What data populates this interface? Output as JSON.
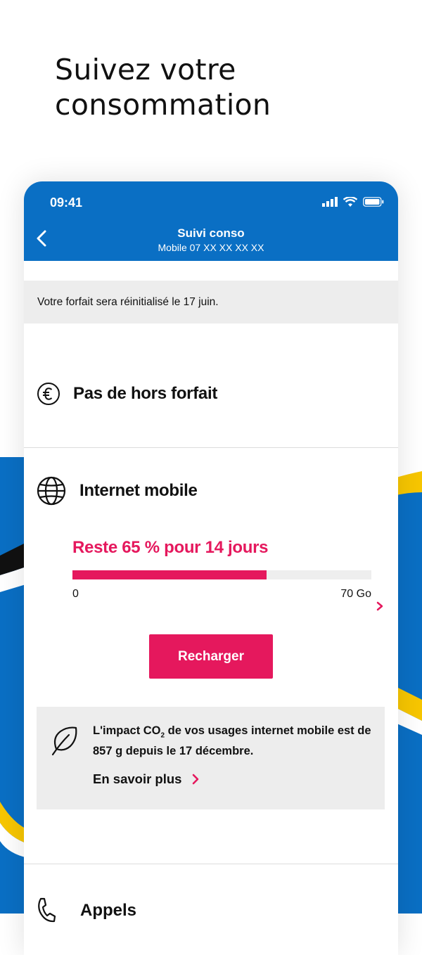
{
  "headline": "Suivez votre consommation",
  "status_bar": {
    "time": "09:41"
  },
  "nav": {
    "title": "Suivi conso",
    "subtitle": "Mobile 07 XX XX XX XX"
  },
  "banner": {
    "text": "Votre forfait sera réinitialisé le 17 juin."
  },
  "hors_forfait": {
    "label": "Pas de hors forfait",
    "icon": "euro-icon"
  },
  "internet": {
    "label": "Internet mobile",
    "icon": "globe-icon",
    "remaining_text": "Reste 65 % pour 14 jours",
    "remaining_percent": 65,
    "scale_min": "0",
    "scale_max": "70 Go",
    "recharge_label": "Recharger"
  },
  "co2": {
    "icon": "leaf-icon",
    "text_before": "L'impact CO",
    "text_sub": "2",
    "text_after": " de vos usages internet mobile est de 857 g depuis le 17 décembre.",
    "link_label": "En savoir plus"
  },
  "appels": {
    "label": "Appels",
    "icon": "phone-icon"
  },
  "colors": {
    "primary_blue": "#0a6fc4",
    "accent_pink": "#e5185d",
    "yellow": "#f7c600",
    "panel_grey": "#ededed"
  }
}
